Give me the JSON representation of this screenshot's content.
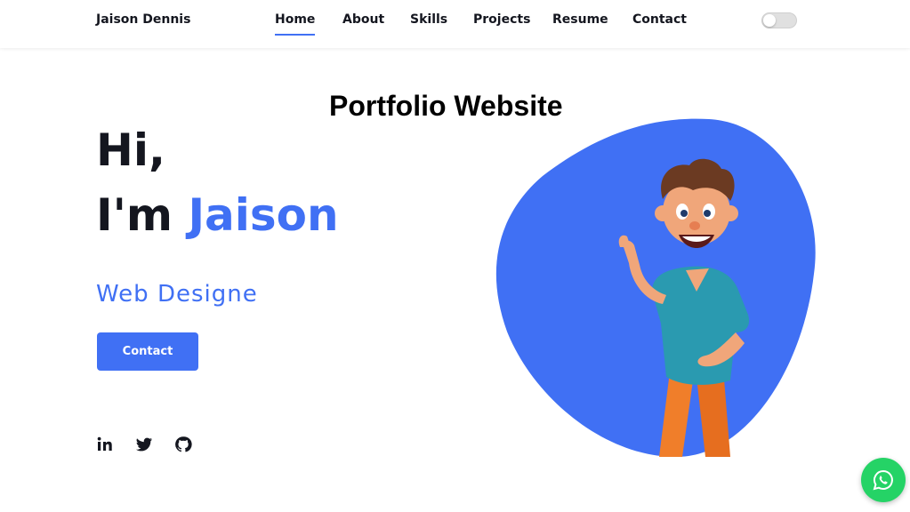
{
  "brand": {
    "name": "Jaison Dennis"
  },
  "nav": {
    "items": [
      {
        "label": "Home",
        "active": true
      },
      {
        "label": "About"
      },
      {
        "label": "Skills"
      },
      {
        "label": "Projects"
      },
      {
        "label": "Resume"
      },
      {
        "label": "Contact"
      }
    ],
    "theme_toggle": {
      "on": false
    }
  },
  "page_heading": "Portfolio Website",
  "hero": {
    "greeting": "Hi,",
    "intro_prefix": "I'm",
    "name": "Jaison",
    "role": "Web Designe",
    "contact_button": "Contact",
    "accent_color": "#4070f4"
  },
  "social": [
    {
      "icon": "linkedin-icon"
    },
    {
      "icon": "twitter-icon"
    },
    {
      "icon": "github-icon"
    }
  ],
  "floating": {
    "icon": "whatsapp-icon",
    "color": "#25d366"
  }
}
